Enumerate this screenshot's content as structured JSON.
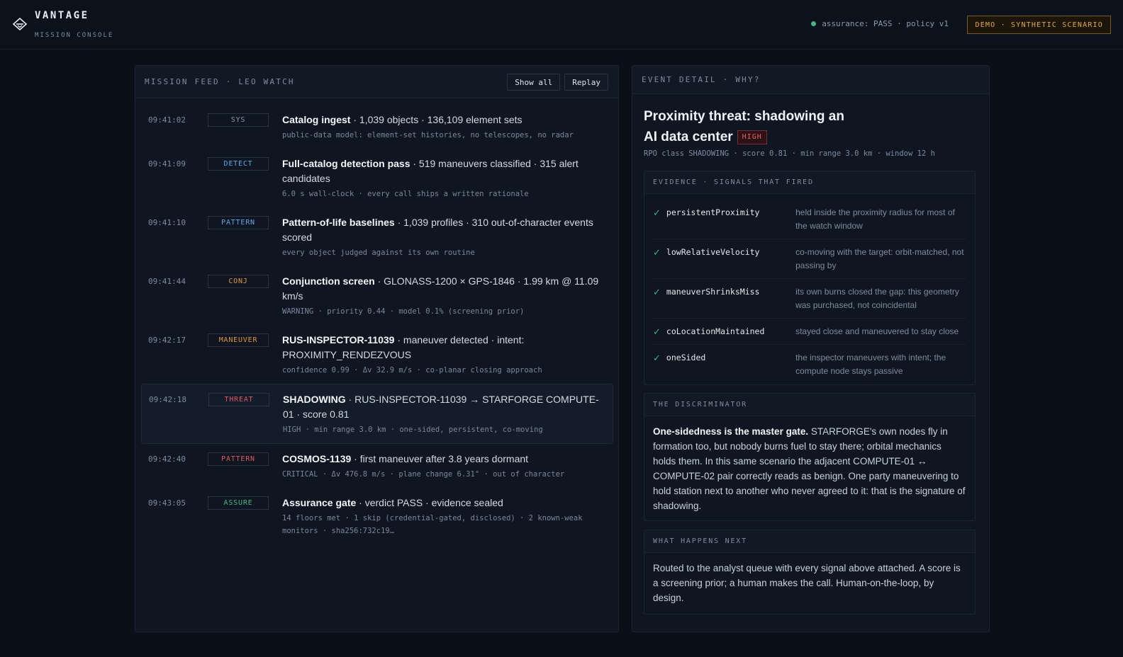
{
  "header": {
    "brand": "VANTAGE",
    "subtitle": "MISSION CONSOLE",
    "status": "assurance: PASS · policy v1",
    "demo_badge": "DEMO · SYNTHETIC SCENARIO",
    "status_color": "#3fb981"
  },
  "feed": {
    "title": "MISSION FEED · LEO WATCH",
    "show_all": "Show all",
    "replay": "Replay",
    "rows": [
      {
        "time": "09:41:02",
        "tag": "SYS",
        "bold": "Catalog ingest",
        "text": " · 1,039 objects · 136,109 element sets",
        "sub": "public-data model: element-set histories, no telescopes, no radar"
      },
      {
        "time": "09:41:09",
        "tag": "DETECT",
        "bold": "Full-catalog detection pass",
        "text": " · 519 maneuvers classified · 315 alert candidates",
        "sub": "6.0 s wall-clock · every call ships a written rationale"
      },
      {
        "time": "09:41:10",
        "tag": "PATTERN",
        "bold": "Pattern-of-life baselines",
        "text": " · 1,039 profiles · 310 out-of-character events scored",
        "sub": "every object judged against its own routine"
      },
      {
        "time": "09:41:44",
        "tag": "CONJ",
        "bold": "Conjunction screen",
        "text": " · GLONASS-1200 × GPS-1846 · 1.99 km @ 11.09 km/s",
        "sub": "WARNING · priority 0.44 · model 0.1% (screening prior)"
      },
      {
        "time": "09:42:17",
        "tag": "MANEUVER",
        "bold": "RUS-INSPECTOR-11039",
        "text": " · maneuver detected · intent: PROXIMITY_RENDEZVOUS",
        "sub": "confidence 0.99 · Δv 32.9 m/s · co-planar closing approach"
      },
      {
        "time": "09:42:18",
        "tag": "THREAT",
        "bold": "SHADOWING",
        "text": " · RUS-INSPECTOR-11039 → STARFORGE COMPUTE-01 · score 0.81",
        "sub": "HIGH · min range 3.0 km · one-sided, persistent, co-moving"
      },
      {
        "time": "09:42:40",
        "tag": "PATTERN",
        "bold": "COSMOS-1139",
        "text": " · first maneuver after 3.8 years dormant",
        "sub": "CRITICAL · Δv 476.8 m/s · plane change 6.31° · out of character"
      },
      {
        "time": "09:43:05",
        "tag": "ASSURE",
        "bold": "Assurance gate",
        "text": " · verdict PASS · evidence sealed",
        "sub": "14 floors met · 1 skip (credential-gated, disclosed) · 2 known-weak monitors · sha256:732c19…"
      }
    ]
  },
  "detail": {
    "title": "EVENT DETAIL · WHY?",
    "event_title": "Proximity threat: shadowing an AI data center",
    "severity": "HIGH",
    "meta": "RPO class SHADOWING · score 0.81 · min range 3.0 km · window 12 h",
    "evidence_title": "EVIDENCE · SIGNALS THAT FIRED",
    "check": "✓",
    "evidence": [
      {
        "name": "persistentProximity",
        "desc": "held inside the proximity radius for most of the watch window"
      },
      {
        "name": "lowRelativeVelocity",
        "desc": "co-moving with the target: orbit-matched, not passing by"
      },
      {
        "name": "maneuverShrinksMiss",
        "desc": "its own burns closed the gap: this geometry was purchased, not coincidental"
      },
      {
        "name": "coLocationMaintained",
        "desc": "stayed close and maneuvered to stay close"
      },
      {
        "name": "oneSided",
        "desc": "the inspector maneuvers with intent; the compute node stays passive"
      }
    ],
    "discriminator_title": "THE DISCRIMINATOR",
    "discriminator_bold": "One-sidedness is the master gate.",
    "discriminator_text": " STARFORGE's own nodes fly in formation too, but nobody burns fuel to stay there; orbital mechanics holds them. In this same scenario the adjacent COMPUTE-01 ↔ COMPUTE-02 pair correctly reads as benign. One party maneuvering to hold station next to another who never agreed to it: that is the signature of shadowing.",
    "next_title": "WHAT HAPPENS NEXT",
    "next_text": "Routed to the analyst queue with every signal above attached. A score is a screening prior; a human makes the call. Human-on-the-loop, by design."
  }
}
